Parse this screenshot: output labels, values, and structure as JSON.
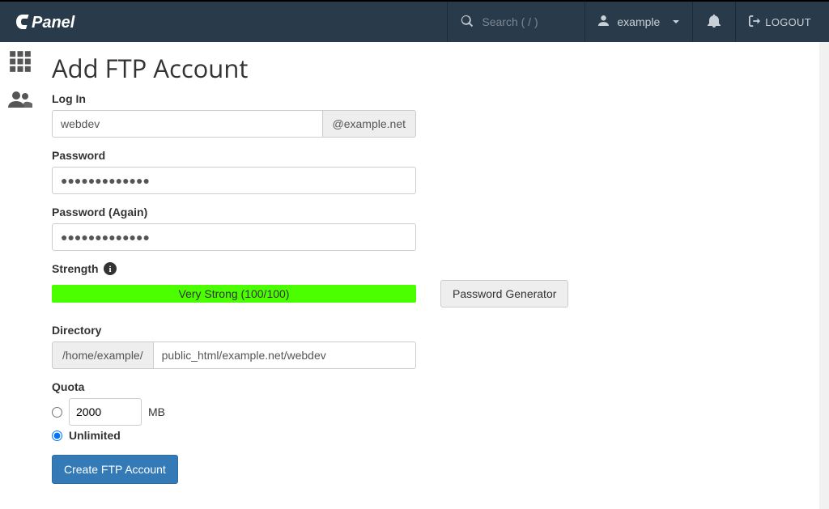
{
  "nav": {
    "search_placeholder": "Search ( / )",
    "user_label": "example",
    "logout_label": "LOGOUT"
  },
  "page": {
    "title": "Add FTP Account"
  },
  "form": {
    "login_label": "Log In",
    "login_value": "webdev",
    "login_domain": "@example.net",
    "password_label": "Password",
    "password_value": "●●●●●●●●●●●●●",
    "password_again_label": "Password (Again)",
    "password_again_value": "●●●●●●●●●●●●●",
    "strength_label": "Strength",
    "strength_text": "Very Strong (100/100)",
    "password_generator_label": "Password Generator",
    "directory_label": "Directory",
    "directory_prefix": "/home/example/",
    "directory_value": "public_html/example.net/webdev",
    "quota_label": "Quota",
    "quota_value": "2000",
    "quota_unit": "MB",
    "quota_unlimited_label": "Unlimited",
    "submit_label": "Create FTP Account"
  }
}
